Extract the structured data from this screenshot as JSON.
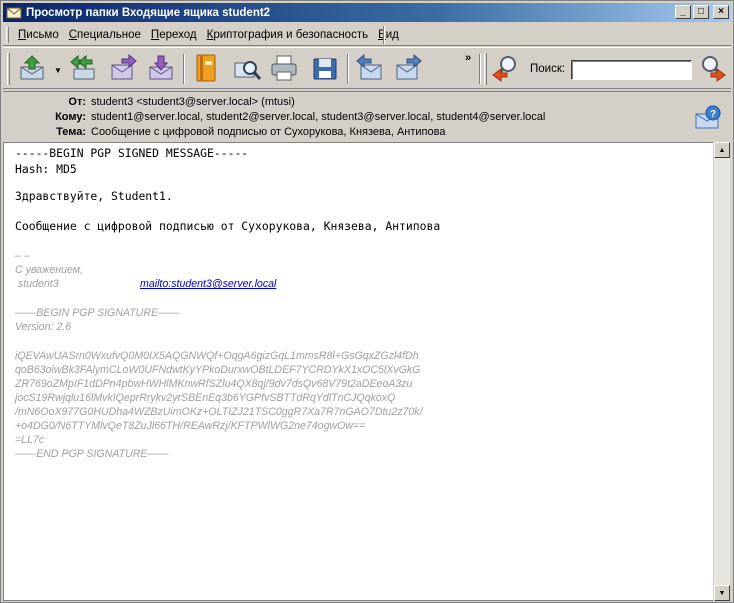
{
  "window": {
    "title": "Просмотр папки Входящие ящика student2",
    "controls": {
      "minimize": "_",
      "maximize": "□",
      "close": "×"
    }
  },
  "menu": [
    "Письмо",
    "Специальное",
    "Переход",
    "Криптография и безопасность",
    "Вид"
  ],
  "menu_underline": [
    "П",
    "С",
    "П",
    "К",
    "В"
  ],
  "toolbar": {
    "overflow": "»",
    "search_label": "Поиск:",
    "search_value": "",
    "search_placeholder": ""
  },
  "headers": {
    "from_label": "От:",
    "from_value": "student3 <student3@server.local>  (mtusi)",
    "to_label": "Кому:",
    "to_value": "student1@server.local, student2@server.local, student3@server.local, student4@server.local",
    "subject_label": "Тема:",
    "subject_value": "Сообщение с цифровой подписью от Сухорукова, Князева, Антипова"
  },
  "body": {
    "pgp_begin": "-----BEGIN PGP SIGNED MESSAGE-----",
    "hash": "Hash: MD5",
    "greeting": "Здравствуйте, Student1.",
    "message": "Сообщение с цифровой подписью от Сухорукова, Князева, Антипова",
    "sig_dash": "– –",
    "sig_regards": "С уважением,",
    "sig_name": " student3",
    "sig_mailto": "mailto:student3@server.local",
    "sig_begin": "——BEGIN PGP SIGNATURE——",
    "sig_version": "Version: 2.6",
    "sig_lines": [
      "iQEVAwUASrn0WxufvQ0M0IX5AQGNWQf+OqgA6gizGqL1mmsR8l+GsGqxZGzl4fDh",
      "qoB63oiwBk3FAlymCLoW0UFNdwtKyYPkoDurxwOBtLDEF7YCRDYkX1xOC5lXvGkG",
      "ZR769oZMpIF1dDPn4pbwHWHlMKnwRfSZlu4QX8qj/9dv7dsQv68V79t2aDEeoA3zu",
      "jocS19Rwjqlu16lMvkIQeprRrykv2yrSBEnEq3b6YGPfvSBTTdRqYdlTnCJQqkoxQ",
      "/mN6OoX977G0HUDha4WZBzUimOKz+OLTIZJ21TSC0ggR7Xa7R7nGAO7Dtu2z70k/",
      "+o4DG0/N6TTYMlvQeT8ZuJl66TH/REAwRzj/KFTPWlWG2ne74ogwOw==",
      "=LL7c"
    ],
    "sig_end": "——END PGP SIGNATURE——"
  },
  "scrollbar": {
    "up": "▲",
    "down": "▼"
  }
}
